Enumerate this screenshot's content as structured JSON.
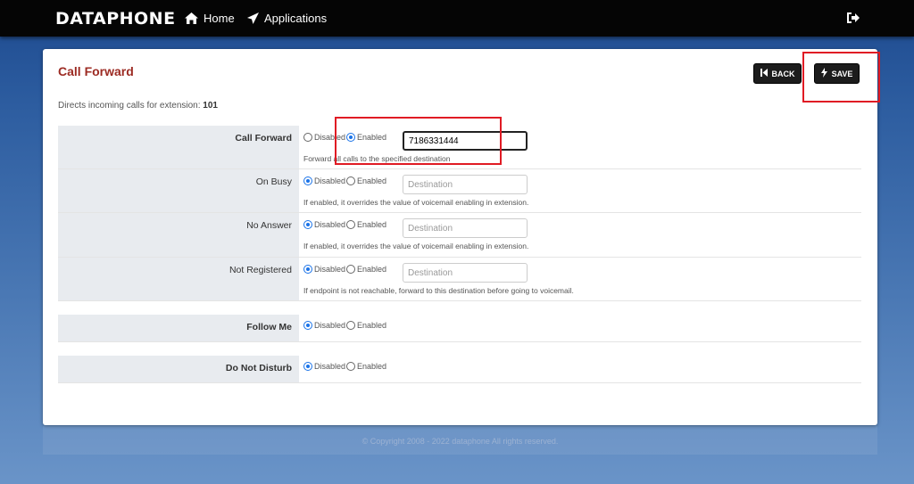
{
  "nav": {
    "brand": "DATAPHONE",
    "home_label": "Home",
    "applications_label": "Applications"
  },
  "page": {
    "title": "Call Forward",
    "description_prefix": "Directs incoming calls for extension:",
    "extension": "101",
    "back_label": "BACK",
    "save_label": "SAVE"
  },
  "rows": [
    {
      "label": "Call Forward",
      "disabled": "Disabled",
      "enabled": "Enabled",
      "selected": "enabled",
      "value": "7186331444",
      "placeholder": "Destination",
      "help": "Forward all calls to the specified destination"
    },
    {
      "label": "On Busy",
      "disabled": "Disabled",
      "enabled": "Enabled",
      "selected": "disabled",
      "value": "",
      "placeholder": "Destination",
      "help": "If enabled, it overrides the value of voicemail enabling in extension."
    },
    {
      "label": "No Answer",
      "disabled": "Disabled",
      "enabled": "Enabled",
      "selected": "disabled",
      "value": "",
      "placeholder": "Destination",
      "help": "If enabled, it overrides the value of voicemail enabling in extension."
    },
    {
      "label": "Not Registered",
      "disabled": "Disabled",
      "enabled": "Enabled",
      "selected": "disabled",
      "value": "",
      "placeholder": "Destination",
      "help": "If endpoint is not reachable, forward to this destination before going to voicemail."
    },
    {
      "label": "Follow Me",
      "disabled": "Disabled",
      "enabled": "Enabled",
      "selected": "disabled"
    },
    {
      "label": "Do Not Disturb",
      "disabled": "Disabled",
      "enabled": "Enabled",
      "selected": "disabled"
    }
  ],
  "footer": {
    "copyright": "© Copyright 2008 - 2022 dataphone All rights reserved."
  },
  "colors": {
    "title": "#9c2b23",
    "highlight": "#e01b24",
    "radio_accent": "#1a73e8"
  },
  "icons": [
    "home-icon",
    "paper-plane-icon",
    "logout-icon",
    "back-icon",
    "bolt-icon"
  ]
}
